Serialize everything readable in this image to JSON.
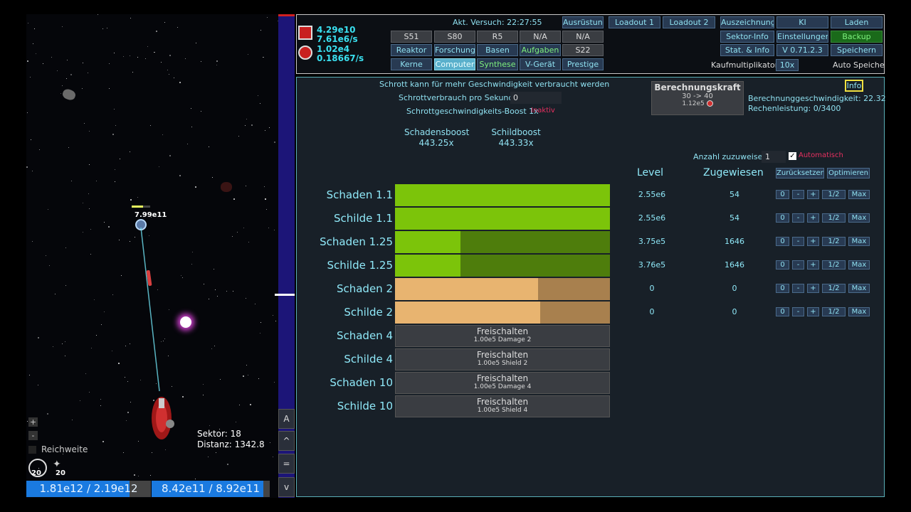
{
  "resources": {
    "scrap": "4.29e10",
    "scrap_rate": "7.61e6/s",
    "energy": "1.02e4",
    "energy_rate": "0.18667/s"
  },
  "top": {
    "current_attempt": "Akt. Versuch: 22:27:55",
    "stats": [
      "S51",
      "S80",
      "R5",
      "N/A",
      "N/A"
    ],
    "nav": [
      "Reaktor",
      "Forschung",
      "Basen",
      "Aufgaben",
      "S22",
      "Kerne",
      "Computer",
      "Synthese",
      "V-Gerät",
      "Prestige"
    ],
    "equipment": "Ausrüstung",
    "loadout1": "Loadout 1",
    "loadout2": "Loadout 2",
    "right_buttons": [
      "Auszeichnung",
      "KI",
      "Laden",
      "Sektor-Info",
      "Einstellungen",
      "Backup",
      "Stat. & Info",
      "V 0.71.2.3",
      "Speichern"
    ],
    "buy_multiplier_label": "Kaufmultiplikator:",
    "buy_multiplier": "10x",
    "auto_save": "Auto Speichern"
  },
  "computer": {
    "scrap_text": "Schrott kann für mehr Geschwindigkeit verbraucht werden",
    "scrap_per_second_label": "Schrottverbrauch pro Sekunde",
    "scrap_per_second_value": "0",
    "scrap_boost_label": "Schrottgeschwindigkeits-Boost 1x",
    "scrap_boost_status": "Inaktiv",
    "damage_boost_label": "Schadensboost",
    "damage_boost_value": "443.25x",
    "shield_boost_label": "Schildboost",
    "shield_boost_value": "443.33x",
    "compute_power_title": "Berechnungskraft",
    "compute_power_range": "30 -> 40",
    "compute_power_cost": "1.12e5",
    "info_button": "Info",
    "compute_speed": "Berechnunggeschwindigkeit: 22.32",
    "compute_usage": "Rechenleistung: 0/3400",
    "assign_count_label": "Anzahl zuzuweisen",
    "assign_count_value": "1",
    "automatic_label": "Automatisch",
    "automatic_checked": true,
    "level_header": "Level",
    "assigned_header": "Zugewiesen",
    "reset_button": "Zurücksetzen",
    "optimize_button": "Optimieren",
    "unlock_label": "Freischalten",
    "row_buttons": [
      "0",
      "-",
      "+",
      "1/2",
      "Max"
    ],
    "rows": [
      {
        "label": "Schaden 1.1",
        "level": "2.55e6",
        "assigned": "54",
        "progress": 1.0,
        "color": "#7cc40a",
        "bg": "#5a8a0a"
      },
      {
        "label": "Schilde 1.1",
        "level": "2.55e6",
        "assigned": "54",
        "progress": 1.0,
        "color": "#7cc40a",
        "bg": "#5a8a0a"
      },
      {
        "label": "Schaden 1.25",
        "level": "3.75e5",
        "assigned": "1646",
        "progress": 0.305,
        "color": "#7cc40a",
        "bg": "#4e7d0c"
      },
      {
        "label": "Schilde 1.25",
        "level": "3.76e5",
        "assigned": "1646",
        "progress": 0.305,
        "color": "#7cc40a",
        "bg": "#4e7d0c"
      },
      {
        "label": "Schaden 2",
        "level": "0",
        "assigned": "0",
        "progress": 0.665,
        "color": "#e8b470",
        "bg": "#a8804e"
      },
      {
        "label": "Schilde 2",
        "level": "0",
        "assigned": "0",
        "progress": 0.675,
        "color": "#e8b470",
        "bg": "#a8804e"
      },
      {
        "label": "Schaden 4",
        "locked": true,
        "cost": "1.00e5 Damage 2"
      },
      {
        "label": "Schilde 4",
        "locked": true,
        "cost": "1.00e5 Shield 2"
      },
      {
        "label": "Schaden 10",
        "locked": true,
        "cost": "1.00e5 Damage 4"
      },
      {
        "label": "Schilde 10",
        "locked": true,
        "cost": "1.00e5 Shield 4"
      }
    ]
  },
  "space": {
    "enemy_hp": "7.99e11",
    "sector": "Sektor: 18",
    "distance": "Distanz: 1342.8",
    "range_label": "Reichweite",
    "count1": "20",
    "count2": "20",
    "hp_bar": "1.81e12 / 2.19e12",
    "shield_bar": "8.42e11 / 8.92e11",
    "hp_fraction": 0.826,
    "shield_fraction": 0.944
  },
  "side_buttons": [
    "A",
    "^",
    "=",
    "v"
  ]
}
